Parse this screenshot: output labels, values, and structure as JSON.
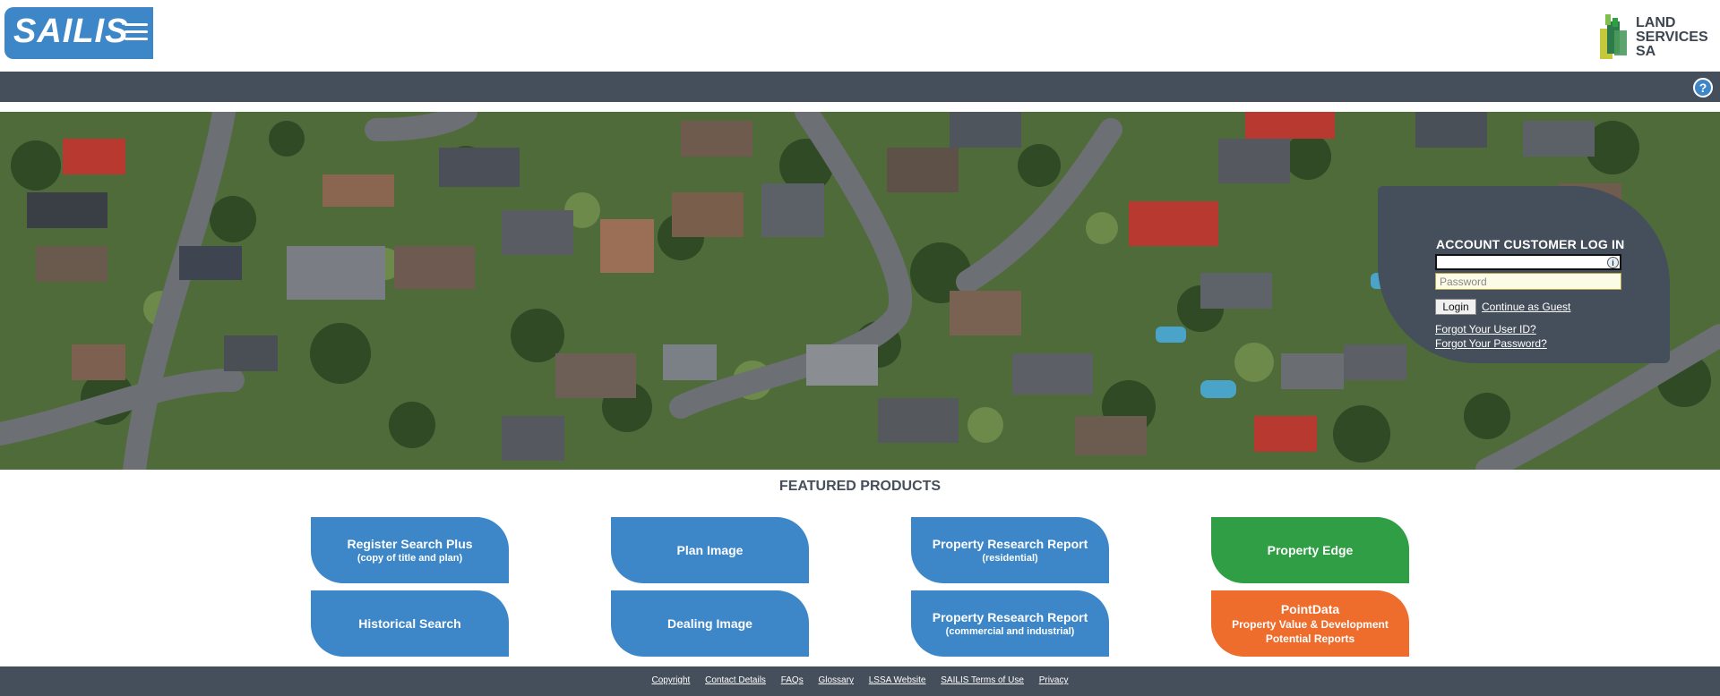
{
  "header": {
    "logo_text": "SAILIS",
    "partner_logo": [
      "LAND",
      "SERVICES",
      "SA"
    ]
  },
  "navbar": {
    "help_icon": "question-circle-icon",
    "help_glyph": "?"
  },
  "login": {
    "title": "ACCOUNT CUSTOMER LOG IN",
    "userid_value": "",
    "password_placeholder": "Password",
    "info_glyph": "i",
    "login_label": "Login",
    "guest_link": "Continue as Guest",
    "forgot_userid": "Forgot Your User ID?",
    "forgot_password": "Forgot Your Password?"
  },
  "featured": {
    "title": "FEATURED PRODUCTS",
    "products": [
      {
        "title": "Register Search Plus",
        "subtitle": "(copy of title and plan)",
        "color": "#3d86c8"
      },
      {
        "title": "Plan Image",
        "subtitle": "",
        "color": "#3d86c8"
      },
      {
        "title": "Property Research Report",
        "subtitle": "(residential)",
        "color": "#3d86c8"
      },
      {
        "title": "Property Edge",
        "subtitle": "",
        "color": "#2f9e44"
      },
      {
        "title": "Historical Search",
        "subtitle": "",
        "color": "#3d86c8"
      },
      {
        "title": "Dealing Image",
        "subtitle": "",
        "color": "#3d86c8"
      },
      {
        "title": "Property Research Report",
        "subtitle": "(commercial and industrial)",
        "color": "#3d86c8"
      },
      {
        "title": "PointData",
        "subtitle": "Property Value & Development Potential Reports",
        "color": "#ee6c2c"
      }
    ]
  },
  "footer": {
    "links": [
      "Copyright",
      "Contact Details",
      "FAQs",
      "Glossary",
      "LSSA Website",
      "SAILIS Terms of Use",
      "Privacy"
    ]
  },
  "colors": {
    "brand_blue": "#3d86c8",
    "dark_slate": "#454f5b",
    "green": "#2f9e44",
    "orange": "#ee6c2c"
  }
}
